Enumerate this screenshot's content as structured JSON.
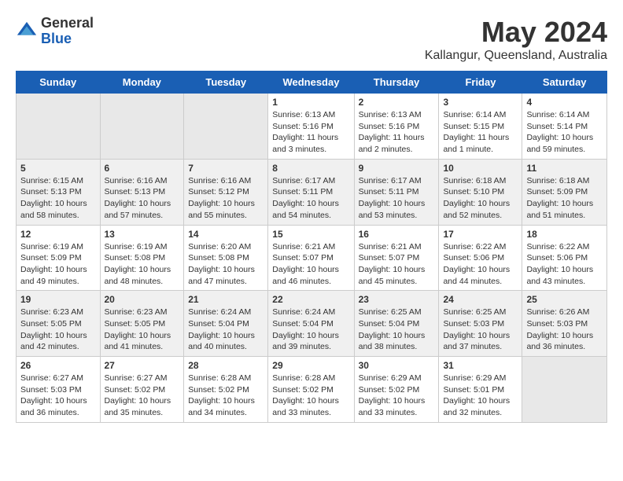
{
  "logo": {
    "general": "General",
    "blue": "Blue"
  },
  "title": "May 2024",
  "subtitle": "Kallangur, Queensland, Australia",
  "weekdays": [
    "Sunday",
    "Monday",
    "Tuesday",
    "Wednesday",
    "Thursday",
    "Friday",
    "Saturday"
  ],
  "weeks": [
    [
      {
        "day": "",
        "content": ""
      },
      {
        "day": "",
        "content": ""
      },
      {
        "day": "",
        "content": ""
      },
      {
        "day": "1",
        "content": "Sunrise: 6:13 AM\nSunset: 5:16 PM\nDaylight: 11 hours\nand 3 minutes."
      },
      {
        "day": "2",
        "content": "Sunrise: 6:13 AM\nSunset: 5:16 PM\nDaylight: 11 hours\nand 2 minutes."
      },
      {
        "day": "3",
        "content": "Sunrise: 6:14 AM\nSunset: 5:15 PM\nDaylight: 11 hours\nand 1 minute."
      },
      {
        "day": "4",
        "content": "Sunrise: 6:14 AM\nSunset: 5:14 PM\nDaylight: 10 hours\nand 59 minutes."
      }
    ],
    [
      {
        "day": "5",
        "content": "Sunrise: 6:15 AM\nSunset: 5:13 PM\nDaylight: 10 hours\nand 58 minutes."
      },
      {
        "day": "6",
        "content": "Sunrise: 6:16 AM\nSunset: 5:13 PM\nDaylight: 10 hours\nand 57 minutes."
      },
      {
        "day": "7",
        "content": "Sunrise: 6:16 AM\nSunset: 5:12 PM\nDaylight: 10 hours\nand 55 minutes."
      },
      {
        "day": "8",
        "content": "Sunrise: 6:17 AM\nSunset: 5:11 PM\nDaylight: 10 hours\nand 54 minutes."
      },
      {
        "day": "9",
        "content": "Sunrise: 6:17 AM\nSunset: 5:11 PM\nDaylight: 10 hours\nand 53 minutes."
      },
      {
        "day": "10",
        "content": "Sunrise: 6:18 AM\nSunset: 5:10 PM\nDaylight: 10 hours\nand 52 minutes."
      },
      {
        "day": "11",
        "content": "Sunrise: 6:18 AM\nSunset: 5:09 PM\nDaylight: 10 hours\nand 51 minutes."
      }
    ],
    [
      {
        "day": "12",
        "content": "Sunrise: 6:19 AM\nSunset: 5:09 PM\nDaylight: 10 hours\nand 49 minutes."
      },
      {
        "day": "13",
        "content": "Sunrise: 6:19 AM\nSunset: 5:08 PM\nDaylight: 10 hours\nand 48 minutes."
      },
      {
        "day": "14",
        "content": "Sunrise: 6:20 AM\nSunset: 5:08 PM\nDaylight: 10 hours\nand 47 minutes."
      },
      {
        "day": "15",
        "content": "Sunrise: 6:21 AM\nSunset: 5:07 PM\nDaylight: 10 hours\nand 46 minutes."
      },
      {
        "day": "16",
        "content": "Sunrise: 6:21 AM\nSunset: 5:07 PM\nDaylight: 10 hours\nand 45 minutes."
      },
      {
        "day": "17",
        "content": "Sunrise: 6:22 AM\nSunset: 5:06 PM\nDaylight: 10 hours\nand 44 minutes."
      },
      {
        "day": "18",
        "content": "Sunrise: 6:22 AM\nSunset: 5:06 PM\nDaylight: 10 hours\nand 43 minutes."
      }
    ],
    [
      {
        "day": "19",
        "content": "Sunrise: 6:23 AM\nSunset: 5:05 PM\nDaylight: 10 hours\nand 42 minutes."
      },
      {
        "day": "20",
        "content": "Sunrise: 6:23 AM\nSunset: 5:05 PM\nDaylight: 10 hours\nand 41 minutes."
      },
      {
        "day": "21",
        "content": "Sunrise: 6:24 AM\nSunset: 5:04 PM\nDaylight: 10 hours\nand 40 minutes."
      },
      {
        "day": "22",
        "content": "Sunrise: 6:24 AM\nSunset: 5:04 PM\nDaylight: 10 hours\nand 39 minutes."
      },
      {
        "day": "23",
        "content": "Sunrise: 6:25 AM\nSunset: 5:04 PM\nDaylight: 10 hours\nand 38 minutes."
      },
      {
        "day": "24",
        "content": "Sunrise: 6:25 AM\nSunset: 5:03 PM\nDaylight: 10 hours\nand 37 minutes."
      },
      {
        "day": "25",
        "content": "Sunrise: 6:26 AM\nSunset: 5:03 PM\nDaylight: 10 hours\nand 36 minutes."
      }
    ],
    [
      {
        "day": "26",
        "content": "Sunrise: 6:27 AM\nSunset: 5:03 PM\nDaylight: 10 hours\nand 36 minutes."
      },
      {
        "day": "27",
        "content": "Sunrise: 6:27 AM\nSunset: 5:02 PM\nDaylight: 10 hours\nand 35 minutes."
      },
      {
        "day": "28",
        "content": "Sunrise: 6:28 AM\nSunset: 5:02 PM\nDaylight: 10 hours\nand 34 minutes."
      },
      {
        "day": "29",
        "content": "Sunrise: 6:28 AM\nSunset: 5:02 PM\nDaylight: 10 hours\nand 33 minutes."
      },
      {
        "day": "30",
        "content": "Sunrise: 6:29 AM\nSunset: 5:02 PM\nDaylight: 10 hours\nand 33 minutes."
      },
      {
        "day": "31",
        "content": "Sunrise: 6:29 AM\nSunset: 5:01 PM\nDaylight: 10 hours\nand 32 minutes."
      },
      {
        "day": "",
        "content": ""
      }
    ]
  ]
}
